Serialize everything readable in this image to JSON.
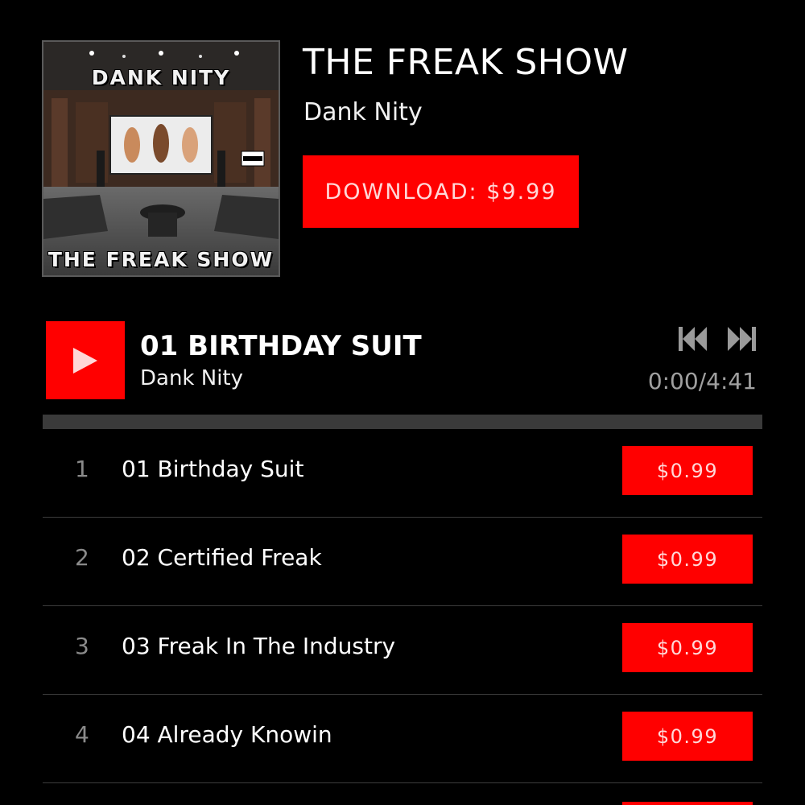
{
  "album": {
    "title": "THE FREAK SHOW",
    "artist": "Dank Nity",
    "download_label": "DOWNLOAD: $9.99",
    "cover": {
      "top_text": "DANK NITY",
      "bottom_text": "THE FREAK SHOW"
    }
  },
  "player": {
    "track_title": "01 BIRTHDAY SUIT",
    "track_artist": "Dank Nity",
    "time": "0:00/4:41",
    "progress": 0,
    "play_icon": "play-icon",
    "prev_icon": "skip-previous-icon",
    "next_icon": "skip-next-icon"
  },
  "tracks": [
    {
      "number": "1",
      "title": "01 Birthday Suit",
      "price": "$0.99"
    },
    {
      "number": "2",
      "title": "02 Certified Freak",
      "price": "$0.99"
    },
    {
      "number": "3",
      "title": "03 Freak In The Industry",
      "price": "$0.99"
    },
    {
      "number": "4",
      "title": "04 Already Knowin",
      "price": "$0.99"
    }
  ],
  "colors": {
    "background": "#000000",
    "accent": "#ff0000",
    "button_text": "#ffd8d8",
    "muted_text": "#a0a0a0",
    "divider": "#3c3c3c",
    "progress_track": "#3a3a3a"
  }
}
